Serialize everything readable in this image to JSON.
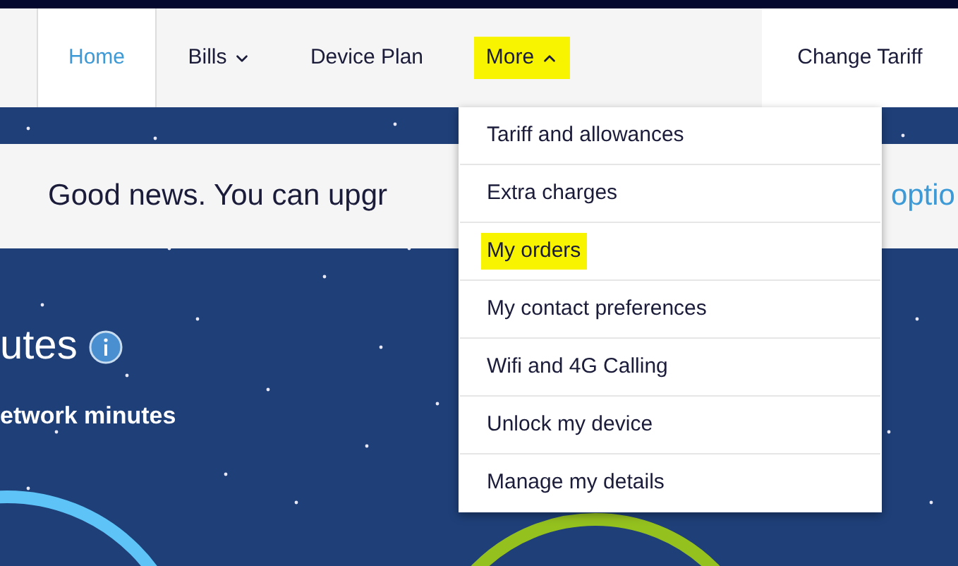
{
  "nav": {
    "items": [
      {
        "label": "Home",
        "kind": "link",
        "selected": true,
        "highlighted": false
      },
      {
        "label": "Bills",
        "kind": "menu",
        "selected": false,
        "expanded": false,
        "highlighted": false
      },
      {
        "label": "Device Plan",
        "kind": "link",
        "selected": false,
        "highlighted": false
      },
      {
        "label": "More",
        "kind": "menu",
        "selected": false,
        "expanded": true,
        "highlighted": true
      }
    ],
    "action": "Change Tariff"
  },
  "banner": {
    "text": "Good news. You can upgr",
    "link": "optio"
  },
  "usage": {
    "title": "utes",
    "subtitle": "etwork minutes"
  },
  "dropdown": {
    "items": [
      {
        "label": "Tariff and allowances",
        "highlighted": false
      },
      {
        "label": "Extra charges",
        "highlighted": false
      },
      {
        "label": "My orders",
        "highlighted": true
      },
      {
        "label": "My contact preferences",
        "highlighted": false
      },
      {
        "label": "Wifi and 4G Calling",
        "highlighted": false
      },
      {
        "label": "Unlock my device",
        "highlighted": false
      },
      {
        "label": "Manage my details",
        "highlighted": false
      }
    ]
  }
}
